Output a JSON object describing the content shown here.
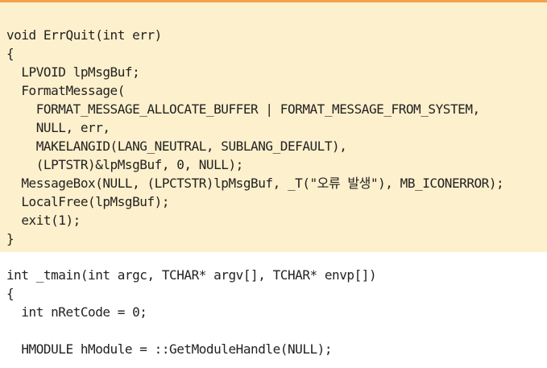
{
  "colors": {
    "top_rule": "#f3a24a",
    "highlight_background": "#fdf0cc",
    "page_background": "#ffffff",
    "code_text": "#222222"
  },
  "highlighted_code": {
    "lines": [
      "void ErrQuit(int err)",
      "{",
      "  LPVOID lpMsgBuf;",
      "  FormatMessage(",
      "    FORMAT_MESSAGE_ALLOCATE_BUFFER | FORMAT_MESSAGE_FROM_SYSTEM,",
      "    NULL, err,",
      "    MAKELANGID(LANG_NEUTRAL, SUBLANG_DEFAULT),",
      "    (LPTSTR)&lpMsgBuf, 0, NULL);",
      "  MessageBox(NULL, (LPCTSTR)lpMsgBuf, _T(\"오류 발생\"), MB_ICONERROR);",
      "  LocalFree(lpMsgBuf);",
      "  exit(1);",
      "}"
    ]
  },
  "plain_code": {
    "lines": [
      "int _tmain(int argc, TCHAR* argv[], TCHAR* envp[])",
      "{",
      "  int nRetCode = 0;",
      "",
      "  HMODULE hModule = ::GetModuleHandle(NULL);"
    ]
  }
}
